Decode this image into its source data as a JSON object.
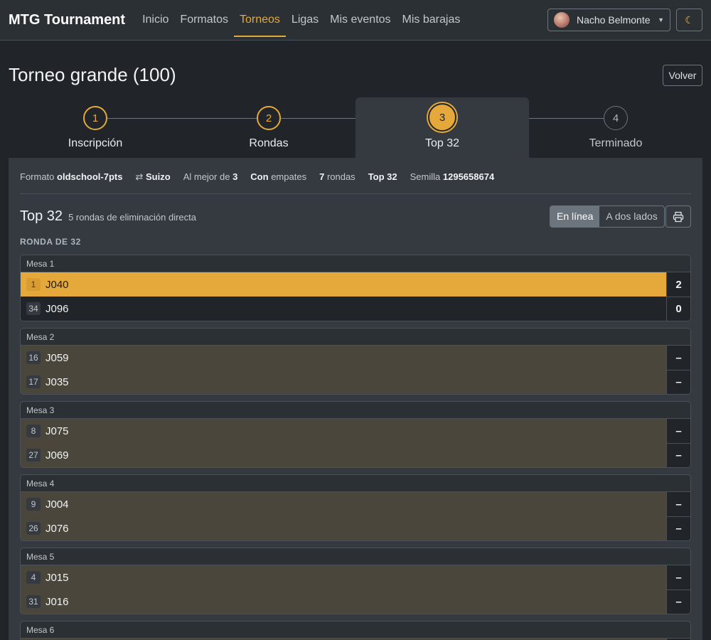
{
  "nav": {
    "brand": "MTG Tournament",
    "links": [
      "Inicio",
      "Formatos",
      "Torneos",
      "Ligas",
      "Mis eventos",
      "Mis barajas"
    ],
    "active_index": 2,
    "user_name": "Nacho Belmonte",
    "theme_icon": "moon-icon"
  },
  "header": {
    "title": "Torneo grande (100)",
    "back_label": "Volver"
  },
  "stepper": [
    {
      "num": "1",
      "label": "Inscripción",
      "state": "done"
    },
    {
      "num": "2",
      "label": "Rondas",
      "state": "done"
    },
    {
      "num": "3",
      "label": "Top 32",
      "state": "current"
    },
    {
      "num": "4",
      "label": "Terminado",
      "state": "todo"
    }
  ],
  "meta": {
    "format_label": "Formato",
    "format_value": "oldschool-7pts",
    "system_value": "Suizo",
    "best_of_label": "Al mejor de",
    "best_of_value": "3",
    "draws_value": "Con",
    "draws_label": "empates",
    "rounds_value": "7",
    "rounds_label": "rondas",
    "top_value": "Top 32",
    "seed_label": "Semilla",
    "seed_value": "1295658674"
  },
  "bracket": {
    "title": "Top 32",
    "subtitle": "5 rondas de eliminación directa",
    "view_inline": "En línea",
    "view_two_sides": "A dos lados",
    "print_icon": "printer-icon",
    "round_label": "RONDA DE 32"
  },
  "matches": [
    {
      "table": "Mesa 1",
      "players": [
        {
          "seed": "1",
          "name": "J040",
          "score": "2",
          "status": "winner"
        },
        {
          "seed": "34",
          "name": "J096",
          "score": "0",
          "status": "loser"
        }
      ]
    },
    {
      "table": "Mesa 2",
      "players": [
        {
          "seed": "16",
          "name": "J059",
          "score": "–",
          "status": "pending"
        },
        {
          "seed": "17",
          "name": "J035",
          "score": "–",
          "status": "pending"
        }
      ]
    },
    {
      "table": "Mesa 3",
      "players": [
        {
          "seed": "8",
          "name": "J075",
          "score": "–",
          "status": "pending"
        },
        {
          "seed": "27",
          "name": "J069",
          "score": "–",
          "status": "pending"
        }
      ]
    },
    {
      "table": "Mesa 4",
      "players": [
        {
          "seed": "9",
          "name": "J004",
          "score": "–",
          "status": "pending"
        },
        {
          "seed": "26",
          "name": "J076",
          "score": "–",
          "status": "pending"
        }
      ]
    },
    {
      "table": "Mesa 5",
      "players": [
        {
          "seed": "4",
          "name": "J015",
          "score": "–",
          "status": "pending"
        },
        {
          "seed": "31",
          "name": "J016",
          "score": "–",
          "status": "pending"
        }
      ]
    },
    {
      "table": "Mesa 6",
      "players": []
    }
  ],
  "colors": {
    "accent": "#e5a93b",
    "pending_row": "#4a463b",
    "background": "#212529"
  }
}
